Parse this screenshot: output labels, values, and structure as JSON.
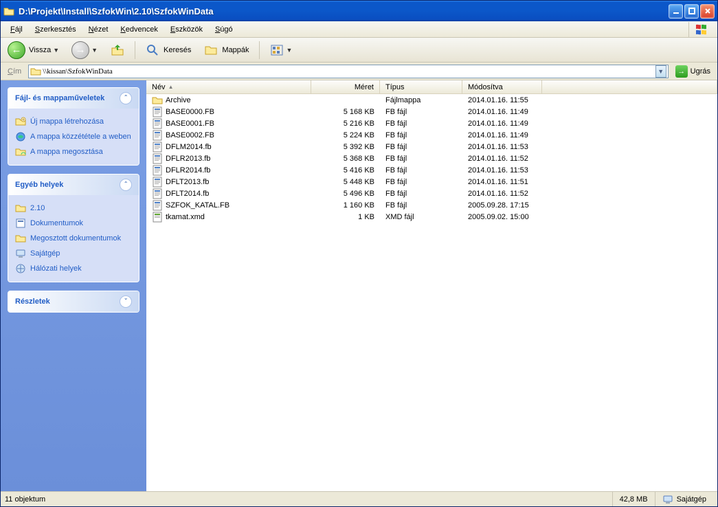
{
  "window": {
    "title": "D:\\Projekt\\Install\\SzfokWin\\2.10\\SzfokWinData"
  },
  "menus": {
    "file": "Fájl",
    "edit": "Szerkesztés",
    "view": "Nézet",
    "fav": "Kedvencek",
    "tools": "Eszközök",
    "help": "Súgó"
  },
  "toolbar": {
    "back": "Vissza",
    "search": "Keresés",
    "folders": "Mappák"
  },
  "address": {
    "label": "Cím",
    "value": "\\\\kissan\\SzfokWinData",
    "go": "Ugrás"
  },
  "columns": {
    "name": "Név",
    "size": "Méret",
    "type": "Típus",
    "modified": "Módosítva"
  },
  "sidepanel": {
    "tasks": {
      "title": "Fájl- és mappaműveletek",
      "items": [
        {
          "label": "Új mappa létrehozása"
        },
        {
          "label": "A mappa közzététele a weben"
        },
        {
          "label": "A mappa megosztása"
        }
      ]
    },
    "places": {
      "title": "Egyéb helyek",
      "items": [
        {
          "label": "2.10"
        },
        {
          "label": "Dokumentumok"
        },
        {
          "label": "Megosztott dokumentumok"
        },
        {
          "label": "Sajátgép"
        },
        {
          "label": "Hálózati helyek"
        }
      ]
    },
    "details": {
      "title": "Részletek"
    }
  },
  "files": [
    {
      "icon": "folder",
      "name": "Archive",
      "size": "",
      "type": "Fájlmappa",
      "mod": "2014.01.16. 11:55"
    },
    {
      "icon": "fb",
      "name": "BASE0000.FB",
      "size": "5 168 KB",
      "type": "FB fájl",
      "mod": "2014.01.16. 11:49"
    },
    {
      "icon": "fb",
      "name": "BASE0001.FB",
      "size": "5 216 KB",
      "type": "FB fájl",
      "mod": "2014.01.16. 11:49"
    },
    {
      "icon": "fb",
      "name": "BASE0002.FB",
      "size": "5 224 KB",
      "type": "FB fájl",
      "mod": "2014.01.16. 11:49"
    },
    {
      "icon": "fb",
      "name": "DFLM2014.fb",
      "size": "5 392 KB",
      "type": "FB fájl",
      "mod": "2014.01.16. 11:53"
    },
    {
      "icon": "fb",
      "name": "DFLR2013.fb",
      "size": "5 368 KB",
      "type": "FB fájl",
      "mod": "2014.01.16. 11:52"
    },
    {
      "icon": "fb",
      "name": "DFLR2014.fb",
      "size": "5 416 KB",
      "type": "FB fájl",
      "mod": "2014.01.16. 11:53"
    },
    {
      "icon": "fb",
      "name": "DFLT2013.fb",
      "size": "5 448 KB",
      "type": "FB fájl",
      "mod": "2014.01.16. 11:51"
    },
    {
      "icon": "fb",
      "name": "DFLT2014.fb",
      "size": "5 496 KB",
      "type": "FB fájl",
      "mod": "2014.01.16. 11:52"
    },
    {
      "icon": "fb",
      "name": "SZFOK_KATAL.FB",
      "size": "1 160 KB",
      "type": "FB fájl",
      "mod": "2005.09.28. 17:15"
    },
    {
      "icon": "xmd",
      "name": "tkamat.xmd",
      "size": "1 KB",
      "type": "XMD fájl",
      "mod": "2005.09.02. 15:00"
    }
  ],
  "status": {
    "count": "11 objektum",
    "size": "42,8 MB",
    "location": "Sajátgép"
  }
}
